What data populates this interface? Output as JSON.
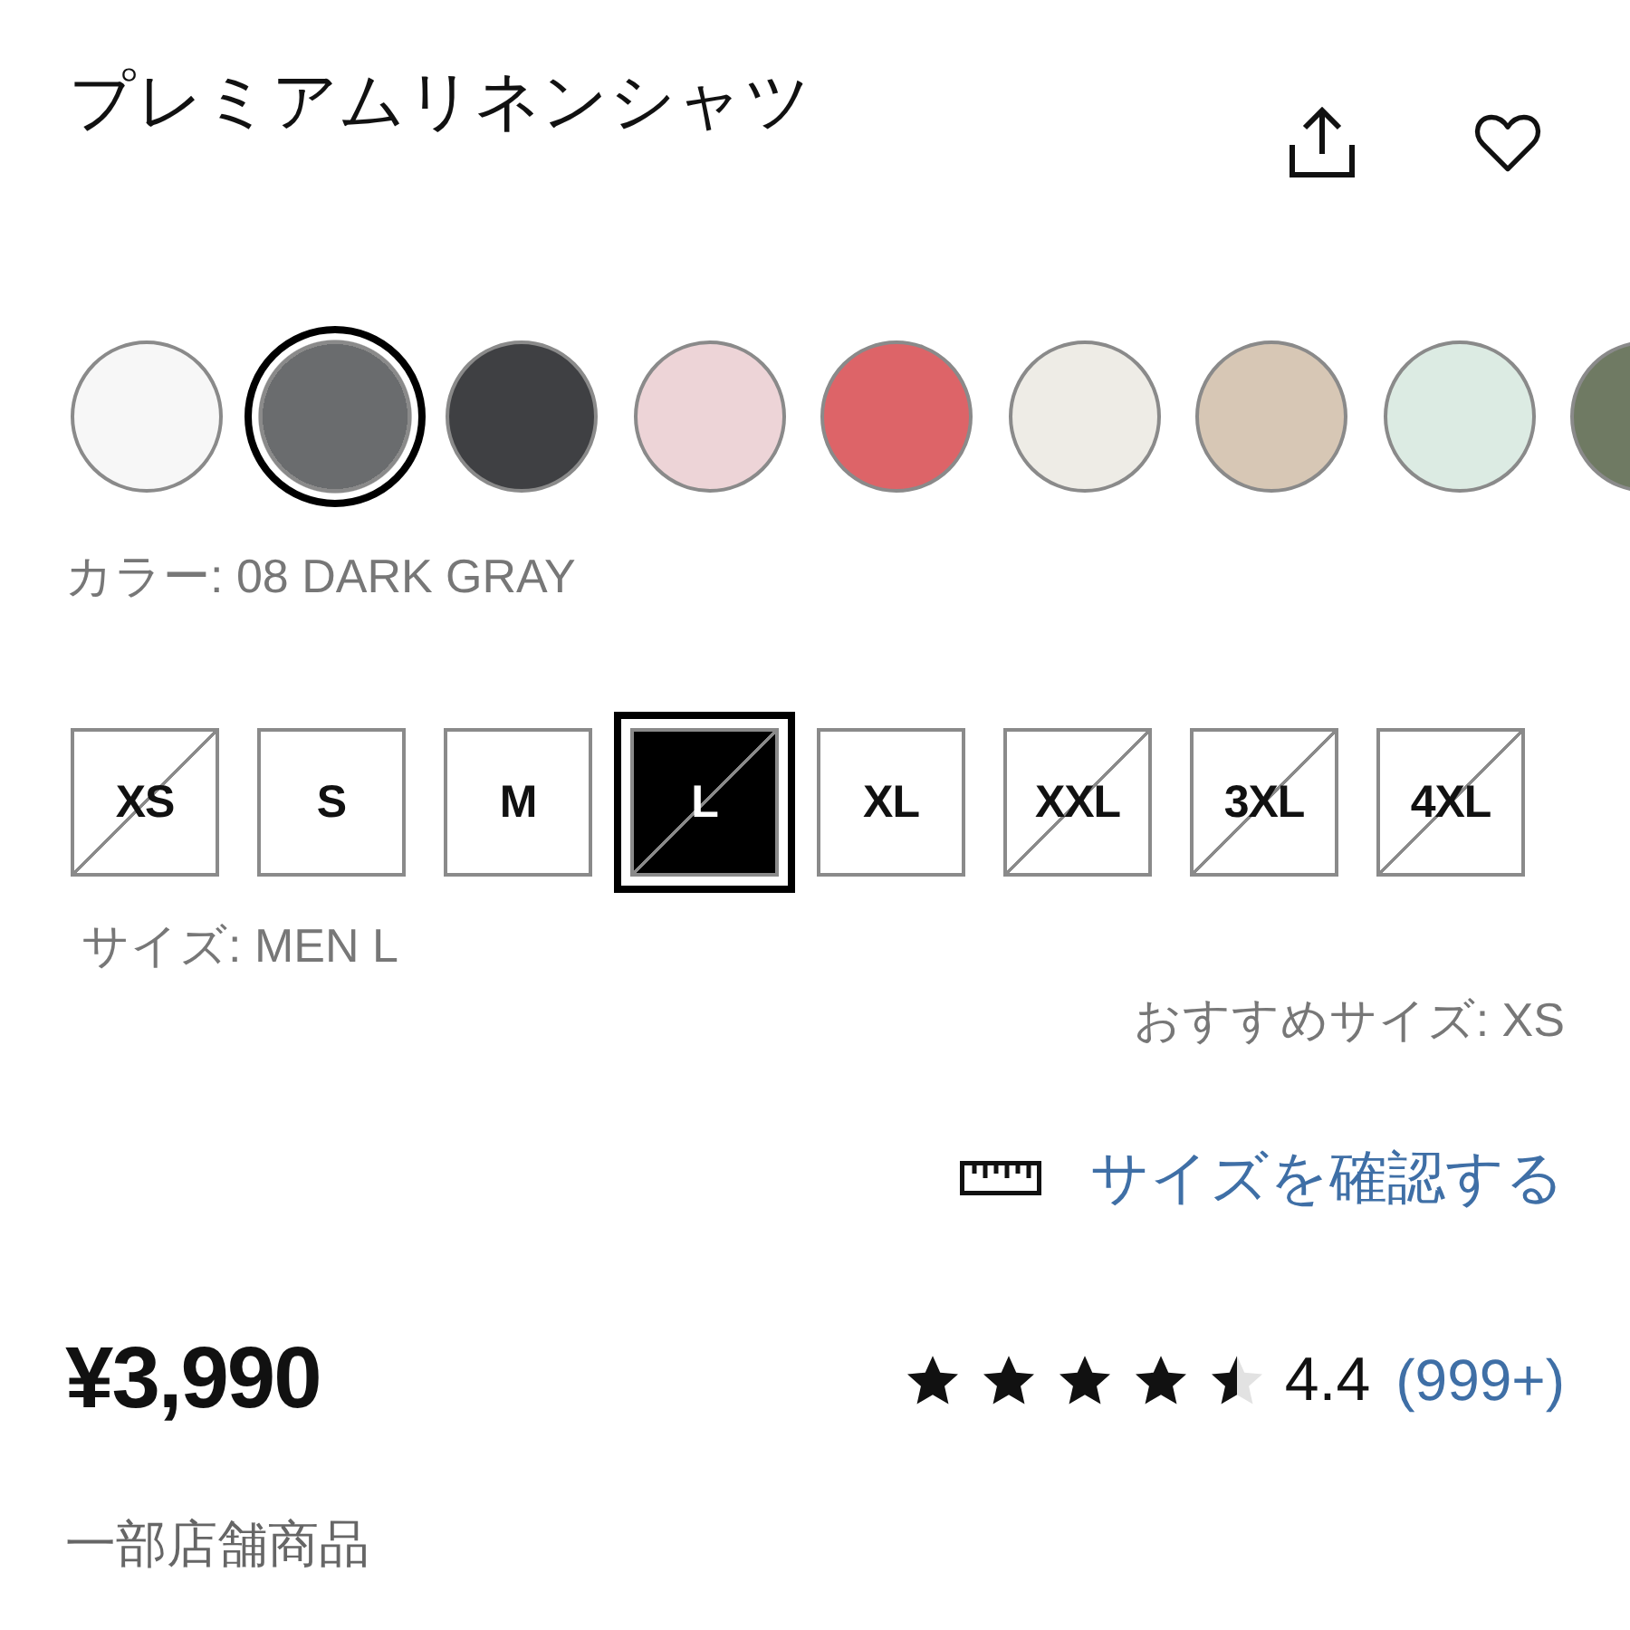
{
  "product": {
    "title": "プレミアムリネンシャツ"
  },
  "colors": {
    "swatches": [
      {
        "color": "#f7f7f7",
        "selected": false
      },
      {
        "color": "#6a6c6e",
        "selected": true
      },
      {
        "color": "#3f4043",
        "selected": false
      },
      {
        "color": "#edd4d7",
        "selected": false
      },
      {
        "color": "#dd6468",
        "selected": false
      },
      {
        "color": "#eeece6",
        "selected": false
      },
      {
        "color": "#d7c7b5",
        "selected": false
      },
      {
        "color": "#dcebe3",
        "selected": false
      },
      {
        "color": "#6f7a63",
        "selected": false
      }
    ],
    "label": "カラー: 08 DARK GRAY"
  },
  "sizes": {
    "options": [
      {
        "label": "XS",
        "available": false,
        "selected": false
      },
      {
        "label": "S",
        "available": true,
        "selected": false
      },
      {
        "label": "M",
        "available": true,
        "selected": false
      },
      {
        "label": "L",
        "available": false,
        "selected": true
      },
      {
        "label": "XL",
        "available": true,
        "selected": false
      },
      {
        "label": "XXL",
        "available": false,
        "selected": false
      },
      {
        "label": "3XL",
        "available": false,
        "selected": false
      },
      {
        "label": "4XL",
        "available": false,
        "selected": false
      }
    ],
    "label": "サイズ: MEN L",
    "recommended": "おすすめサイズ: XS",
    "guide_link": "サイズを確認する"
  },
  "price": "¥3,990",
  "rating": {
    "stars": 4.5,
    "score": "4.4",
    "count": "(999+)"
  },
  "note": "一部店舗商品"
}
